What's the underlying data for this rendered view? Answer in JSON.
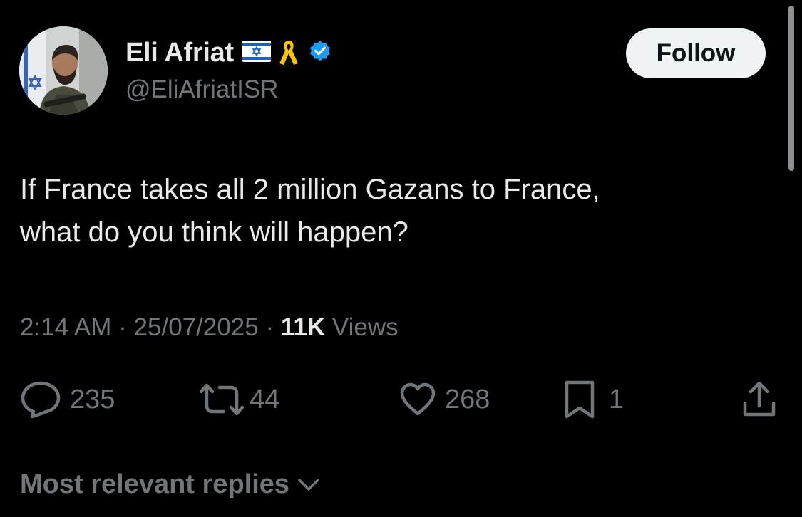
{
  "author": {
    "display_name": "Eli Afriat",
    "handle": "@EliAfriatISR",
    "verified": true
  },
  "follow_label": "Follow",
  "tweet": {
    "lines": [
      "If France takes all 2 million Gazans to France,",
      "what do you think will happen?"
    ],
    "time": "2:14 AM",
    "separator": "·",
    "date": "25/07/2025",
    "views_count": "11K",
    "views_label": "Views"
  },
  "actions": {
    "replies": "235",
    "reposts": "44",
    "likes": "268",
    "bookmarks": "1"
  },
  "replies_sort_label": "Most relevant replies",
  "icons": {
    "avatar": "profile-photo",
    "flag": "israel-flag-icon",
    "ribbon": "yellow-ribbon-icon",
    "verified": "verified-badge-icon",
    "reply": "reply-bubble-icon",
    "repost": "repost-icon",
    "like": "heart-icon",
    "bookmark": "bookmark-icon",
    "share": "share-icon",
    "chevron": "chevron-down-icon"
  },
  "colors": {
    "background": "#000000",
    "primary_text": "#e7e9ea",
    "secondary_text": "#71767b",
    "verified_blue": "#1d9bf0",
    "ribbon_yellow": "#f7c600",
    "follow_button_bg": "#eff3f4"
  }
}
